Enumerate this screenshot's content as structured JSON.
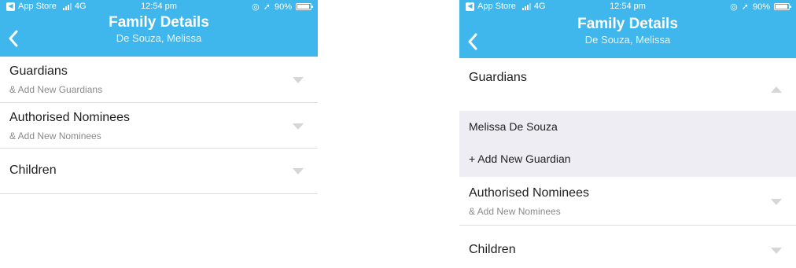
{
  "status_bar": {
    "app_back": "App Store",
    "network": "4G",
    "time": "12:54 pm",
    "battery": "90%"
  },
  "header": {
    "title": "Family Details",
    "subtitle": "De Souza, Melissa"
  },
  "sections": {
    "guardians": {
      "label": "Guardians",
      "sub": "& Add New Guardians"
    },
    "nominees": {
      "label": "Authorised Nominees",
      "sub": "& Add New Nominees"
    },
    "children": {
      "label": "Children"
    }
  },
  "expanded_guardians": {
    "items": [
      "Melissa De Souza",
      "+ Add New Guardian"
    ]
  },
  "colors": {
    "header_bg": "#3fb6ec",
    "expanded_bg": "#ededf3",
    "divider": "#dedede"
  },
  "icons": {
    "back": "chevron-left-icon",
    "collapsed": "caret-down-icon",
    "expanded": "caret-up-icon"
  }
}
